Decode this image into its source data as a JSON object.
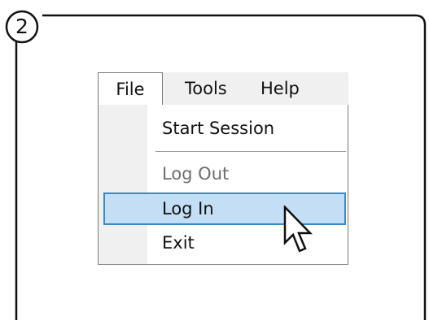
{
  "step": {
    "number": "2"
  },
  "menubar": {
    "items": [
      {
        "label": "File"
      },
      {
        "label": "Tools"
      },
      {
        "label": "Help"
      }
    ]
  },
  "file_menu": {
    "items": [
      {
        "label": "Start Session",
        "enabled": true
      },
      {
        "label": "Log Out",
        "enabled": false
      },
      {
        "label": "Log In",
        "enabled": true,
        "highlighted": true
      },
      {
        "label": "Exit",
        "enabled": true
      }
    ]
  },
  "colors": {
    "highlight_fill": "#c3def5",
    "highlight_border": "#3c8ac4",
    "menubar_bg": "#f0f0f0",
    "disabled_text": "#6d6d6d"
  },
  "icons": {
    "cursor": "arrow-pointer-icon"
  }
}
